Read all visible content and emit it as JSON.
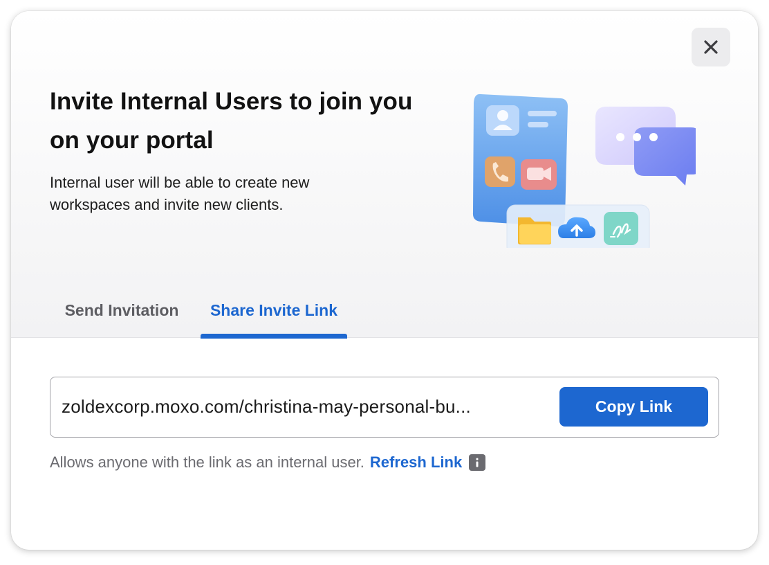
{
  "dialog": {
    "title": "Invite Internal Users to join you on your portal",
    "subtitle": "Internal user will be able to create new workspaces and invite new clients.",
    "close_icon": "close-icon"
  },
  "tabs": [
    {
      "label": "Send Invitation",
      "active": false
    },
    {
      "label": "Share Invite Link",
      "active": true
    }
  ],
  "share": {
    "link_value": "zoldexcorp.moxo.com/christina-may-personal-bu...",
    "copy_label": "Copy Link",
    "helper_text": "Allows anyone with the link as an internal user.",
    "refresh_label": "Refresh Link",
    "info_icon": "info-icon"
  },
  "colors": {
    "accent": "#1d67d0",
    "title": "#121212",
    "muted": "#6b6b70",
    "hero_bg": "#f4f4f6"
  }
}
